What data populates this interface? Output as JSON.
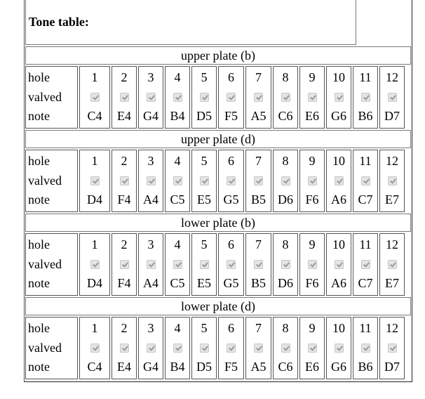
{
  "title": "Tone table:",
  "row_labels": {
    "hole": "hole",
    "valved": "valved",
    "note": "note"
  },
  "plates": [
    {
      "name": "upper plate (b)",
      "holes": [
        "1",
        "2",
        "3",
        "4",
        "5",
        "6",
        "7",
        "8",
        "9",
        "10",
        "11",
        "12"
      ],
      "valved": [
        true,
        true,
        true,
        true,
        true,
        true,
        true,
        true,
        true,
        true,
        true,
        true
      ],
      "notes": [
        "C4",
        "E4",
        "G4",
        "B4",
        "D5",
        "F5",
        "A5",
        "C6",
        "E6",
        "G6",
        "B6",
        "D7"
      ]
    },
    {
      "name": "upper plate (d)",
      "holes": [
        "1",
        "2",
        "3",
        "4",
        "5",
        "6",
        "7",
        "8",
        "9",
        "10",
        "11",
        "12"
      ],
      "valved": [
        true,
        true,
        true,
        true,
        true,
        true,
        true,
        true,
        true,
        true,
        true,
        true
      ],
      "notes": [
        "D4",
        "F4",
        "A4",
        "C5",
        "E5",
        "G5",
        "B5",
        "D6",
        "F6",
        "A6",
        "C7",
        "E7"
      ]
    },
    {
      "name": "lower plate (b)",
      "holes": [
        "1",
        "2",
        "3",
        "4",
        "5",
        "6",
        "7",
        "8",
        "9",
        "10",
        "11",
        "12"
      ],
      "valved": [
        true,
        true,
        true,
        true,
        true,
        true,
        true,
        true,
        true,
        true,
        true,
        true
      ],
      "notes": [
        "D4",
        "F4",
        "A4",
        "C5",
        "E5",
        "G5",
        "B5",
        "D6",
        "F6",
        "A6",
        "C7",
        "E7"
      ]
    },
    {
      "name": "lower plate (d)",
      "holes": [
        "1",
        "2",
        "3",
        "4",
        "5",
        "6",
        "7",
        "8",
        "9",
        "10",
        "11",
        "12"
      ],
      "valved": [
        true,
        true,
        true,
        true,
        true,
        true,
        true,
        true,
        true,
        true,
        true,
        true
      ],
      "notes": [
        "C4",
        "E4",
        "G4",
        "B4",
        "D5",
        "F5",
        "A5",
        "C6",
        "E6",
        "G6",
        "B6",
        "D7"
      ]
    }
  ]
}
